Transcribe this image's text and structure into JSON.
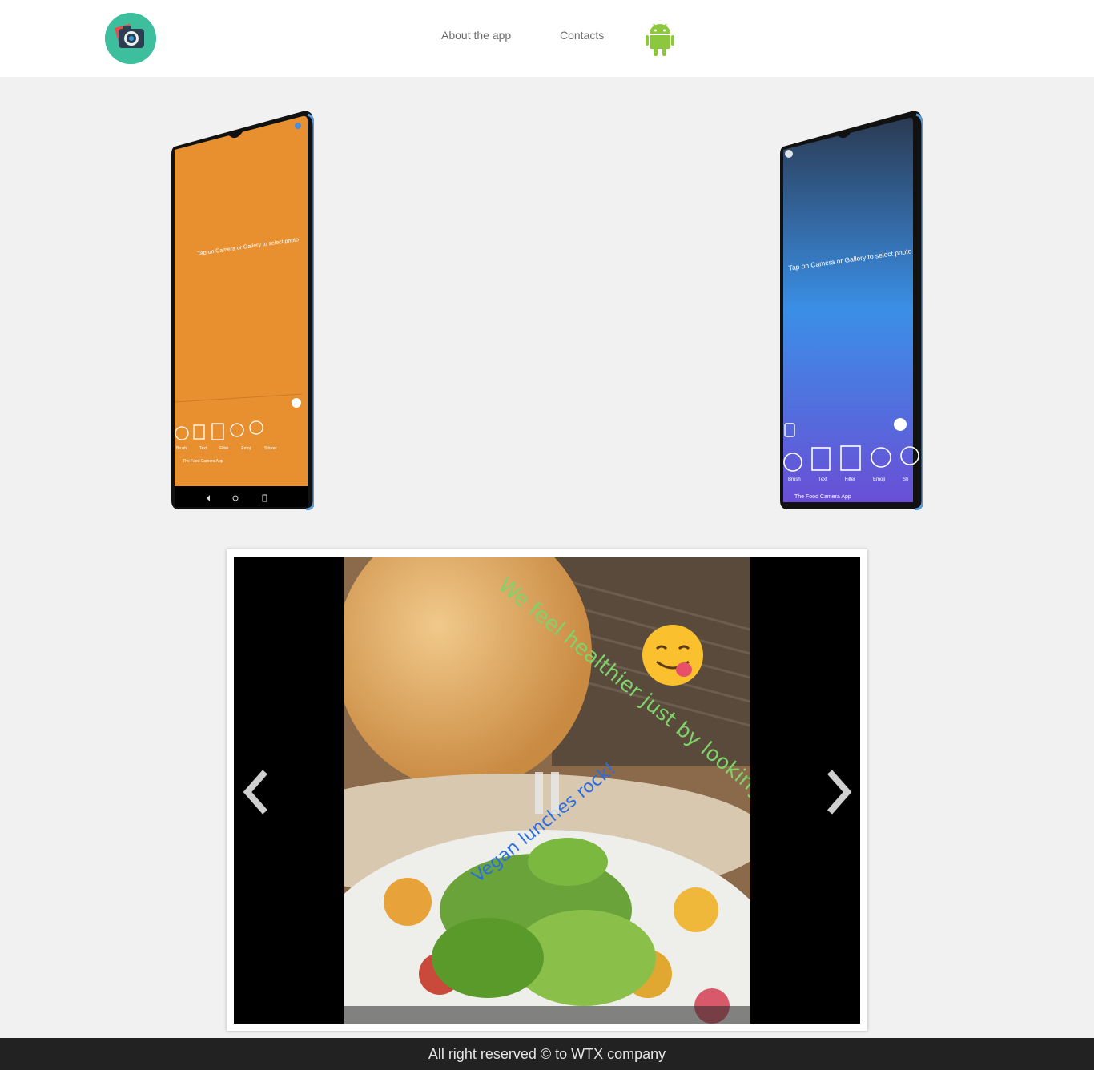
{
  "header": {
    "nav": [
      {
        "label": "About the app"
      },
      {
        "label": "Contacts"
      }
    ]
  },
  "phones": {
    "left": {
      "screen_color": "#e8902f",
      "prompt": "Tap on Camera or Gallery to select photo",
      "tools": [
        "Brush",
        "Text",
        "Filter",
        "Emoji",
        "Sticker"
      ],
      "app_name": "The Food Camera App"
    },
    "right": {
      "prompt": "Tap on Camera or Gallery to select photo",
      "tools": [
        "Brush",
        "Text",
        "Filter",
        "Emoji",
        "Sti"
      ],
      "app_name": "The Food Camera App"
    }
  },
  "slider": {
    "caption_green": "We feel healthier just by looking at this!!!",
    "caption_blue": "Vegan lunches rock!"
  },
  "footer": {
    "text": "All right reserved © to WTX company"
  },
  "colors": {
    "logo_bg": "#3dbf9d",
    "android_green": "#8dc63f",
    "footer_bg": "#222222"
  }
}
